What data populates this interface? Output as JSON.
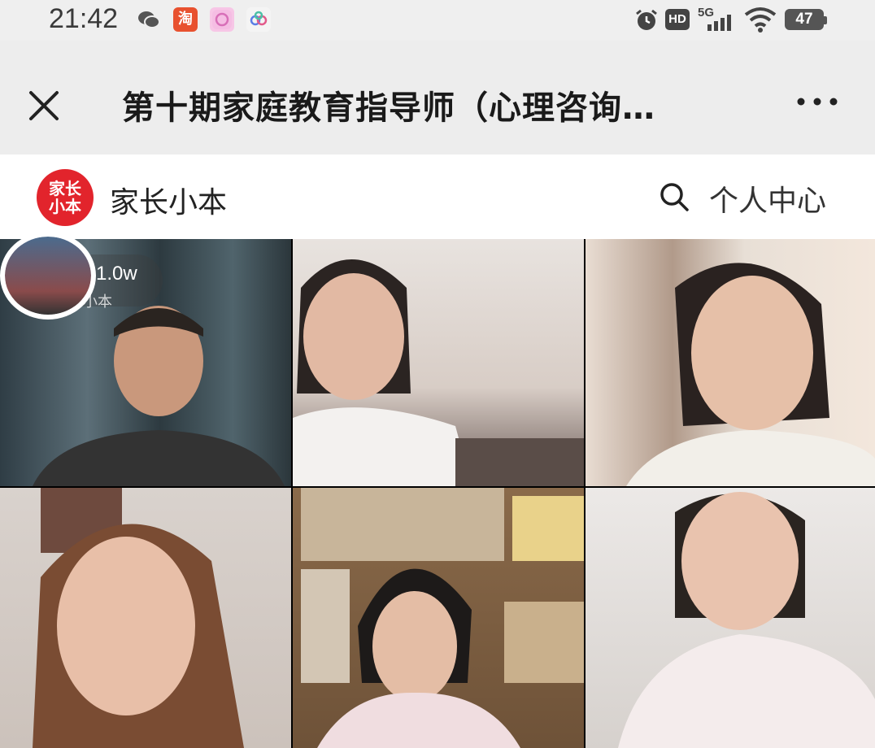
{
  "status_bar": {
    "time": "21:42",
    "network": "5G",
    "hd": "HD",
    "battery": "47",
    "app_icons": [
      "wechat-icon",
      "taobao-icon",
      "camera-icon",
      "cloud-icon"
    ]
  },
  "header": {
    "title": "第十期家庭教育指导师（心理咨询…",
    "close_icon": "close-icon",
    "more_icon": "more-icon"
  },
  "brand": {
    "logo_text": "家长小本",
    "name": "家长小本",
    "personal_center": "个人中心"
  },
  "live": {
    "viewer_count": "1.0w",
    "host_label": "小本"
  },
  "participants": [
    {
      "tile": "participant-tile-1"
    },
    {
      "tile": "participant-tile-2"
    },
    {
      "tile": "participant-tile-3"
    },
    {
      "tile": "participant-tile-4"
    },
    {
      "tile": "participant-tile-5"
    },
    {
      "tile": "participant-tile-6"
    }
  ],
  "colors": {
    "brand_red": "#e2242c",
    "header_bg": "#ededed"
  }
}
